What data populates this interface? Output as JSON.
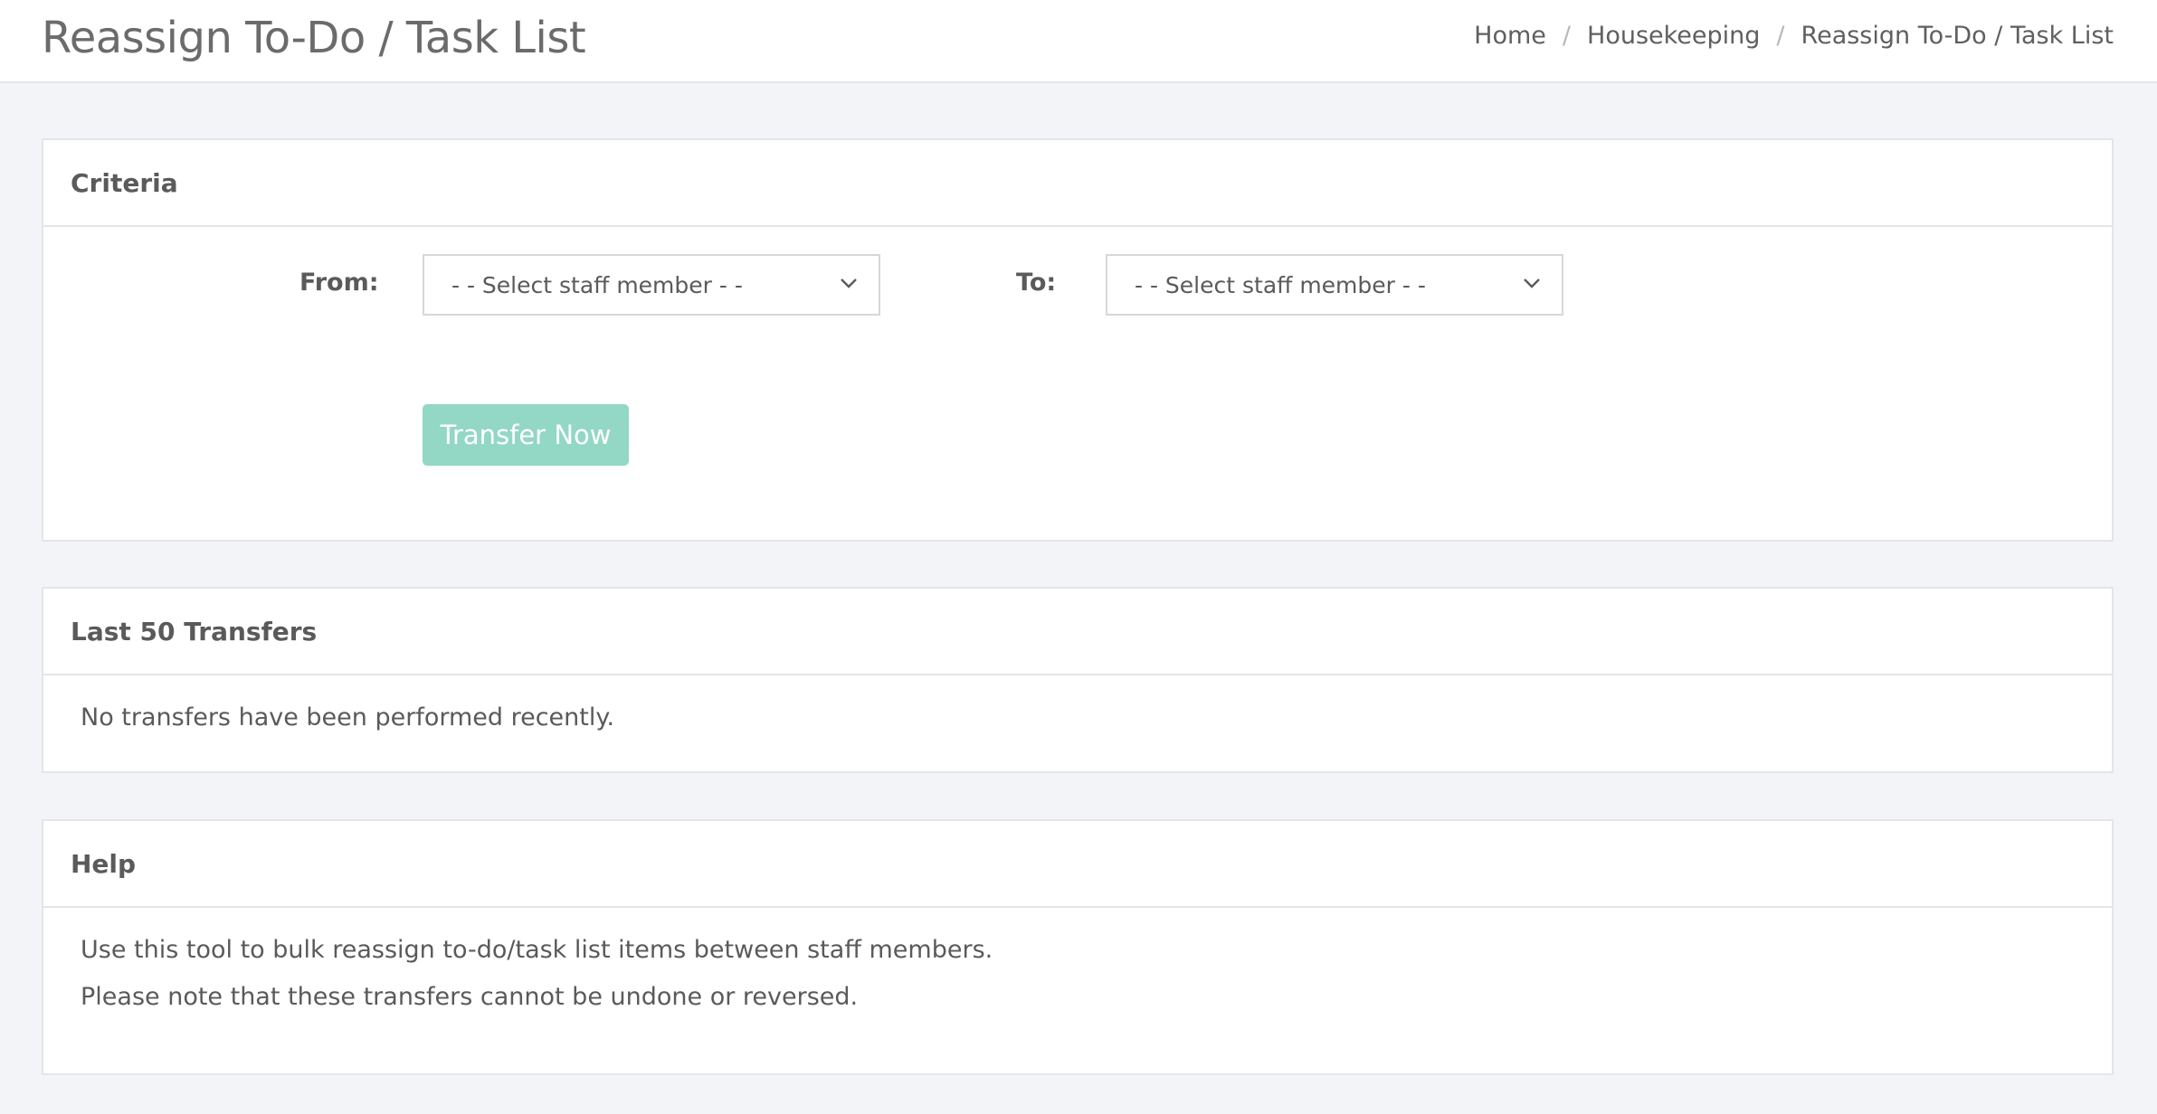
{
  "header": {
    "title": "Reassign To-Do / Task List",
    "breadcrumb": [
      {
        "label": "Home"
      },
      {
        "label": "Housekeeping"
      },
      {
        "label": "Reassign To-Do / Task List"
      }
    ],
    "separator": "/"
  },
  "criteria": {
    "title": "Criteria",
    "from_label": "From:",
    "from_select": "- - Select staff member - -",
    "to_label": "To:",
    "to_select": "- - Select staff member - -",
    "submit_label": "Transfer Now",
    "submit_color": "#93d7c5"
  },
  "transfers": {
    "title": "Last 50 Transfers",
    "empty_message": "No transfers have been performed recently."
  },
  "help": {
    "title": "Help",
    "lines": [
      "Use this tool to bulk reassign to-do/task list items between staff members.",
      "Please note that these transfers cannot be undone or reversed."
    ]
  }
}
